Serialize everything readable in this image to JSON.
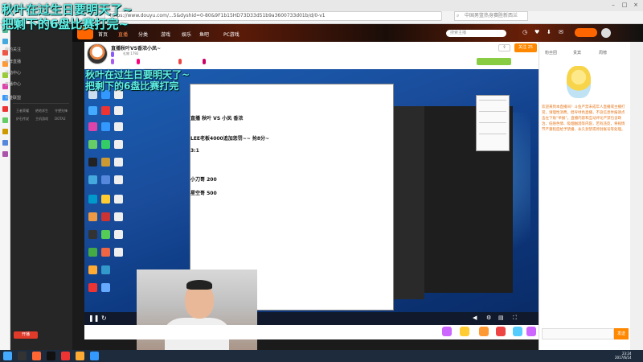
{
  "browser": {
    "address": "https://www.douyu.com/...5&dyshid=0-80&9F1b15HD73D33d51b9a3600733d01b/d/0-v1",
    "search_placeholder": "中国男篮热身赛胜新西兰"
  },
  "site": {
    "nav": [
      "首页",
      "直播",
      "分类",
      "游戏",
      "娱乐",
      "鱼吧",
      "PC游戏"
    ],
    "search_placeholder": "搜索主播",
    "left_nav": [
      "我的关注",
      "推荐直播",
      "活动中心",
      "直播中心",
      "英雄联盟",
      "王者荣耀",
      "绝地求生",
      "守望先锋",
      "炉石传说",
      "主机游戏",
      "DOTA2"
    ],
    "upload_label": "开播"
  },
  "room": {
    "title": "直播秋叶VS香浓小凤~",
    "stats": "礼物 1792",
    "follow_label": "关注",
    "follow_count": "25"
  },
  "doc": {
    "lines": [
      "直播  秋叶  VS  小凤  香浓",
      "LEE老板4000追加惩罚~~  抢8分~",
      "3:1",
      "小刀哥 200",
      "星空哥 500"
    ]
  },
  "captions": {
    "top_line1": "秋叶在过生日要明天了~",
    "top_line2": "把剩下的6盘比赛打完~",
    "stream_line1": "秋叶在过生日要明天了~",
    "stream_line2": "把剩下的6盘比赛打完"
  },
  "chat": {
    "tabs": [
      "粉丝团",
      "贵宾",
      "周榜"
    ],
    "notice": "欢迎来到本直播间！斗鱼严禁未成年人直播或主播打赏，请理性消费，倡导绿色直播，不良信息举报请点击左下角“举报”。直播内容和互动评论严禁包含政治、低俗色情、吸烟酗酒等内容，若有违反，将视情节严重程度给予禁播、永久封禁或停封账号等处理。",
    "input_placeholder": "",
    "send_label": "发送"
  },
  "taskbar": {
    "time": "23:24",
    "date": "2017/6/14"
  },
  "colors": {
    "caption": "#5ff2e8",
    "accent": "#ff8800",
    "stream_bg": "#1a4d9c"
  }
}
